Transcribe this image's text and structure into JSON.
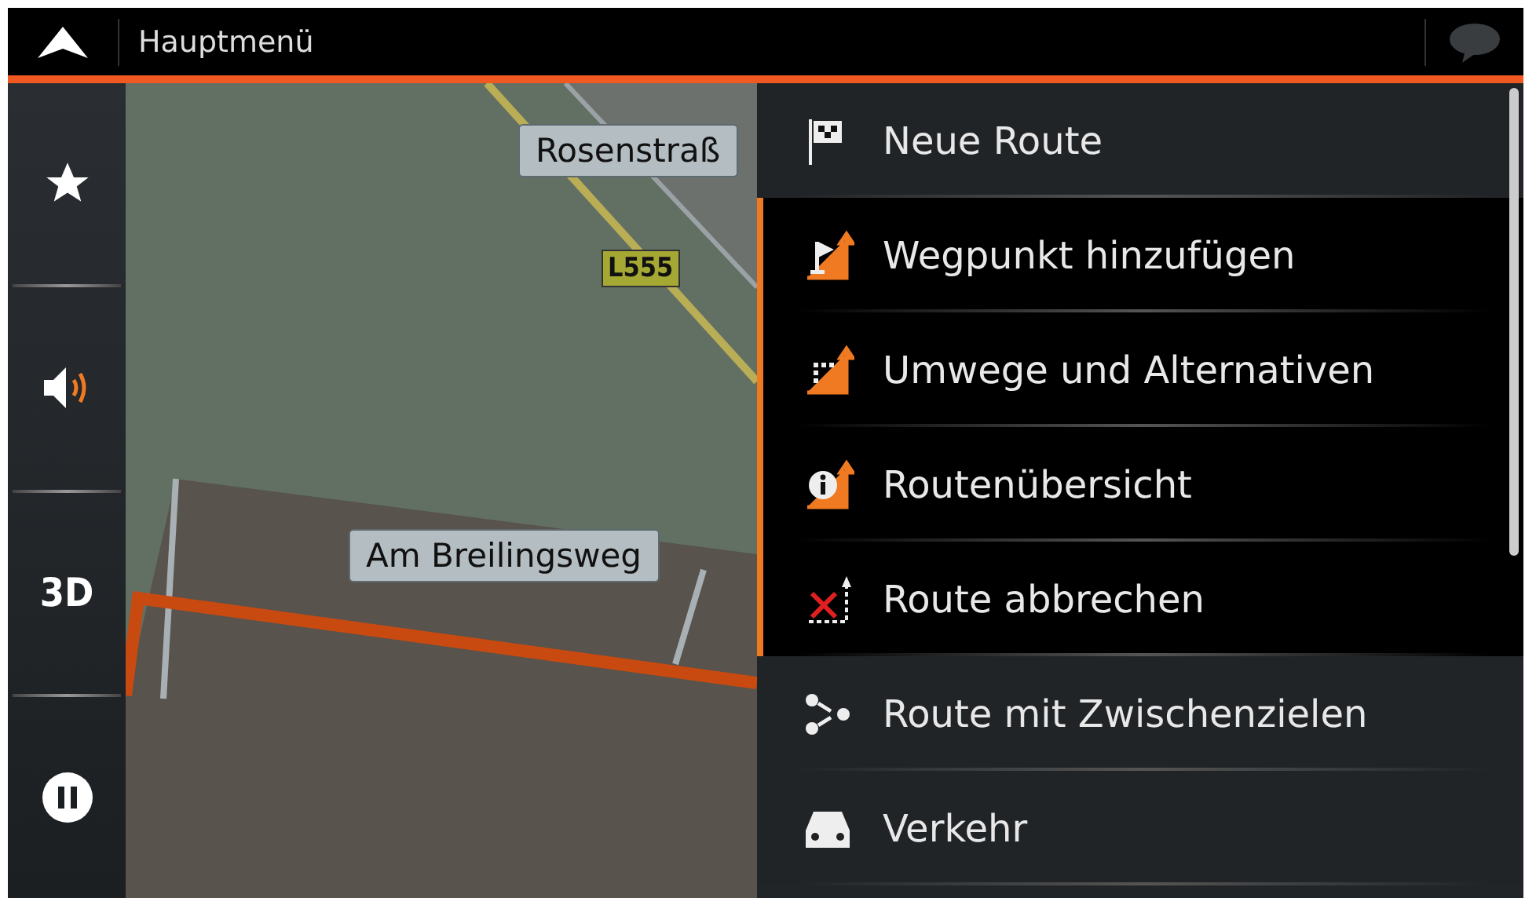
{
  "header": {
    "title": "Hauptmenü"
  },
  "sidebar": {
    "items": [
      {
        "kind": "star"
      },
      {
        "kind": "sound"
      },
      {
        "kind": "text",
        "label": "3D"
      },
      {
        "kind": "pause"
      }
    ]
  },
  "map": {
    "labels": [
      {
        "kind": "street",
        "text": "Rosenstraß"
      },
      {
        "kind": "road-number",
        "text": "L555"
      },
      {
        "kind": "street",
        "text": "Am Breilingsweg"
      }
    ]
  },
  "menu": {
    "items": [
      {
        "kind": "new-route",
        "label": "Neue Route",
        "grouped": false
      },
      {
        "kind": "waypoint",
        "label": "Wegpunkt hinzufügen",
        "grouped": true
      },
      {
        "kind": "detours",
        "label": "Umwege und Alternativen",
        "grouped": true
      },
      {
        "kind": "overview",
        "label": "Routenübersicht",
        "grouped": true
      },
      {
        "kind": "cancel",
        "label": "Route abbrechen",
        "grouped": true
      },
      {
        "kind": "multi",
        "label": "Route mit Zwischenzielen",
        "grouped": false
      },
      {
        "kind": "traffic",
        "label": "Verkehr",
        "grouped": false
      }
    ]
  }
}
